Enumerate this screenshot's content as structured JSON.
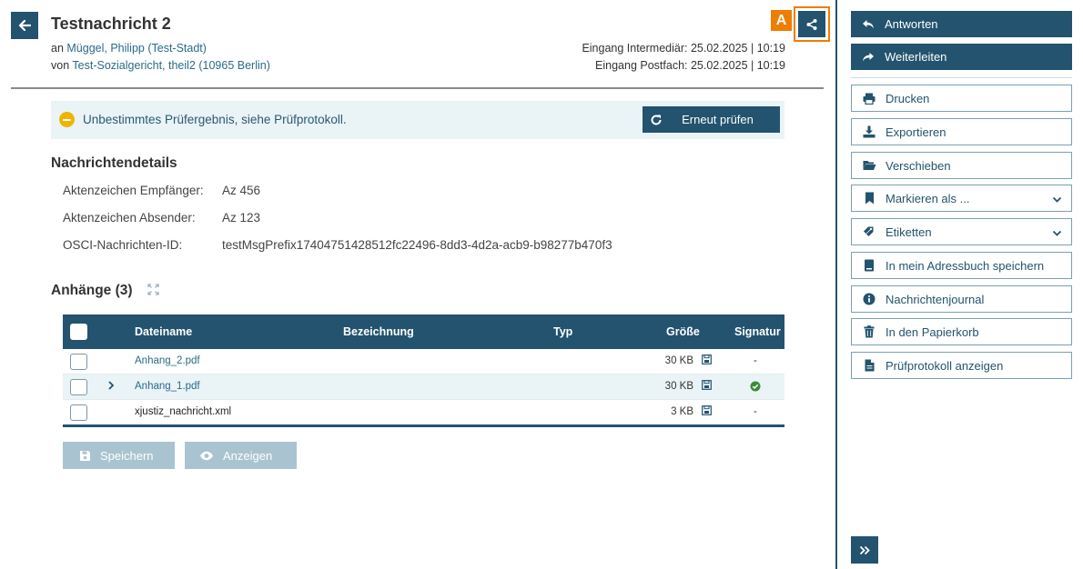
{
  "header": {
    "title": "Testnachricht 2",
    "to_prefix": "an",
    "to_name": "Müggel, Philipp (Test-Stadt)",
    "from_prefix": "von",
    "from_name": "Test-Sozialgericht, theil2 (10965 Berlin)",
    "receipt_intermediary": "Eingang Intermediär: 25.02.2025 | 10:19",
    "receipt_mailbox": "Eingang Postfach: 25.02.2025 | 10:19",
    "badge_letter": "A"
  },
  "notice": {
    "text": "Unbestimmtes Prüfergebnis, siehe Prüfprotokoll.",
    "recheck_label": "Erneut prüfen"
  },
  "details": {
    "heading": "Nachrichtendetails",
    "rows": [
      {
        "label": "Aktenzeichen Empfänger:",
        "value": "Az 456"
      },
      {
        "label": "Aktenzeichen Absender:",
        "value": "Az 123"
      },
      {
        "label": "OSCI-Nachrichten-ID:",
        "value": "testMsgPrefix17404751428512fc22496-8dd3-4d2a-acb9-b98277b470f3"
      }
    ]
  },
  "attachments": {
    "heading": "Anhänge (3)",
    "columns": {
      "name": "Dateiname",
      "label": "Bezeichnung",
      "type": "Typ",
      "size": "Größe",
      "signature": "Signatur"
    },
    "rows": [
      {
        "name": "Anhang_2.pdf",
        "size": "30 KB",
        "signature": "-",
        "sig_valid": false,
        "expandable": false,
        "link": true
      },
      {
        "name": "Anhang_1.pdf",
        "size": "30 KB",
        "signature": "",
        "sig_valid": true,
        "expandable": true,
        "link": true
      },
      {
        "name": "xjustiz_nachricht.xml",
        "size": "3 KB",
        "signature": "-",
        "sig_valid": false,
        "expandable": false,
        "link": false
      }
    ],
    "save_label": "Speichern",
    "view_label": "Anzeigen"
  },
  "sidebar": {
    "reply": "Antworten",
    "forward": "Weiterleiten",
    "items": [
      {
        "label": "Drucken",
        "icon": "printer-icon"
      },
      {
        "label": "Exportieren",
        "icon": "download-icon"
      },
      {
        "label": "Verschieben",
        "icon": "folder-open-icon"
      },
      {
        "label": "Markieren als ...",
        "icon": "bookmark-icon",
        "dropdown": true
      },
      {
        "label": "Etiketten",
        "icon": "tags-icon",
        "dropdown": true
      },
      {
        "label": "In mein Adressbuch speichern",
        "icon": "address-book-icon"
      },
      {
        "label": "Nachrichtenjournal",
        "icon": "info-circle-icon"
      },
      {
        "label": "In den Papierkorb",
        "icon": "trash-icon"
      },
      {
        "label": "Prüfprotokoll anzeigen",
        "icon": "file-icon"
      }
    ]
  },
  "colors": {
    "primary": "#23536e",
    "accent_orange": "#ef7d00",
    "notice_bg": "#eaf3f6",
    "warning_yellow": "#f0b400",
    "success_green": "#3c8a3c",
    "disabled_btn": "#a9c4d0"
  }
}
